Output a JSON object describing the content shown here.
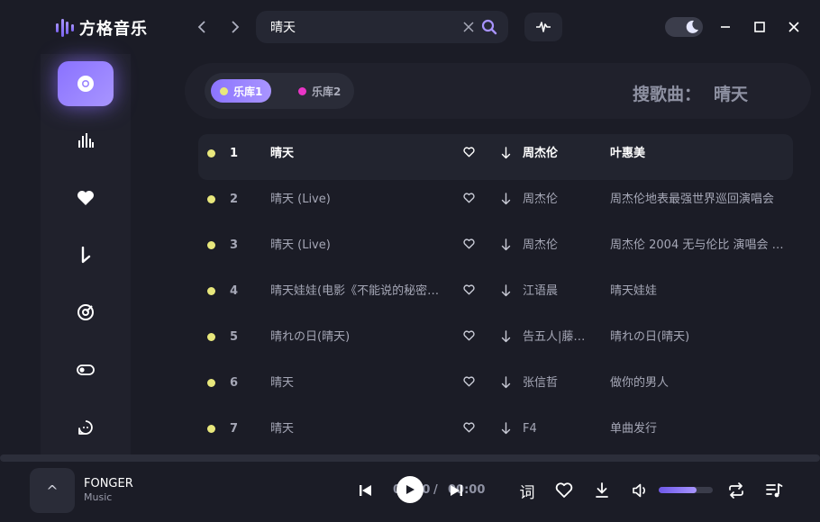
{
  "app": {
    "name": "方格音乐"
  },
  "search": {
    "value": "晴天",
    "clear_glyph": "X"
  },
  "libraries": [
    {
      "label": "乐库1",
      "dot_color": "#e8e77c",
      "active": true
    },
    {
      "label": "乐库2",
      "dot_color": "#e935c6",
      "active": false
    }
  ],
  "results_header": {
    "label": "搜歌曲：",
    "query": "晴天"
  },
  "songs": [
    {
      "index": "1",
      "title": "晴天",
      "artist": "周杰伦",
      "album": "叶惠美"
    },
    {
      "index": "2",
      "title": "晴天 (Live)",
      "artist": "周杰伦",
      "album": "周杰伦地表最强世界巡回演唱会"
    },
    {
      "index": "3",
      "title": "晴天 (Live)",
      "artist": "周杰伦",
      "album": "周杰伦 2004 无与伦比 演唱会 …"
    },
    {
      "index": "4",
      "title": "晴天娃娃(电影《不能说的秘密…",
      "artist": "江语晨",
      "album": "晴天娃娃"
    },
    {
      "index": "5",
      "title": "晴れの日(晴天)",
      "artist": "告五人|藤…",
      "album": "晴れの日(晴天)"
    },
    {
      "index": "6",
      "title": "晴天",
      "artist": "张信哲",
      "album": "做你的男人"
    },
    {
      "index": "7",
      "title": "晴天",
      "artist": "F4",
      "album": "单曲发行"
    }
  ],
  "player": {
    "cover_glyph": "^",
    "track_name": "FONGER",
    "track_artist": "Music",
    "time_current": "00:00",
    "time_separator": "/",
    "time_total": "00:00",
    "lyric_label": "词",
    "volume": 0.7
  },
  "colors": {
    "accent": "#8b74ff",
    "row_dot": "#e8e77c",
    "background": "#1b1c26"
  },
  "icons": {
    "sidebar": [
      "disc-icon",
      "bar-chart-icon",
      "heart-icon",
      "download-icon",
      "target-icon",
      "toggle-icon",
      "chat-icon"
    ]
  }
}
